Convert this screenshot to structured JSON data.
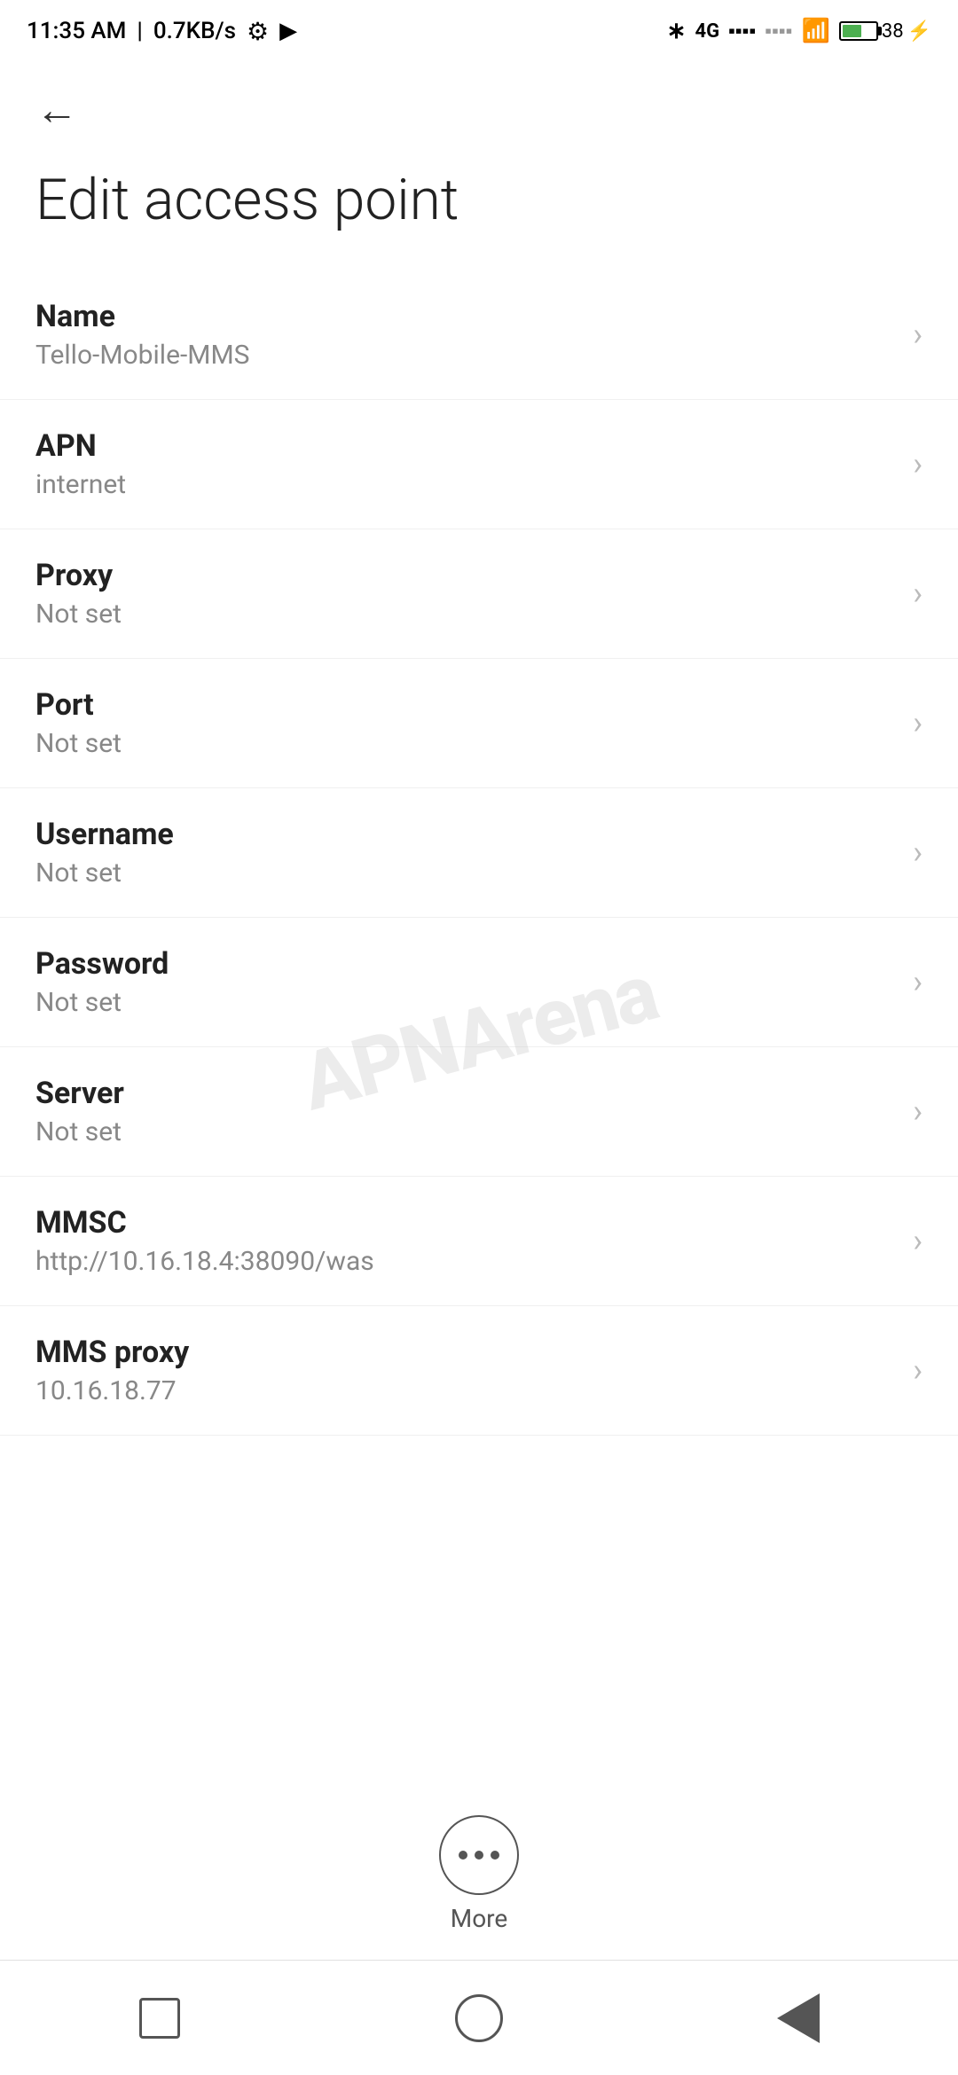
{
  "status_bar": {
    "time": "11:35 AM",
    "speed": "0.7KB/s",
    "battery_percent": "38"
  },
  "header": {
    "back_label": "←",
    "title": "Edit access point"
  },
  "settings": {
    "items": [
      {
        "label": "Name",
        "value": "Tello-Mobile-MMS"
      },
      {
        "label": "APN",
        "value": "internet"
      },
      {
        "label": "Proxy",
        "value": "Not set"
      },
      {
        "label": "Port",
        "value": "Not set"
      },
      {
        "label": "Username",
        "value": "Not set"
      },
      {
        "label": "Password",
        "value": "Not set"
      },
      {
        "label": "Server",
        "value": "Not set"
      },
      {
        "label": "MMSC",
        "value": "http://10.16.18.4:38090/was"
      },
      {
        "label": "MMS proxy",
        "value": "10.16.18.77"
      }
    ]
  },
  "more_button": {
    "label": "More"
  },
  "nav": {
    "square_label": "recent-apps",
    "circle_label": "home",
    "triangle_label": "back"
  },
  "watermark": "APNArena"
}
